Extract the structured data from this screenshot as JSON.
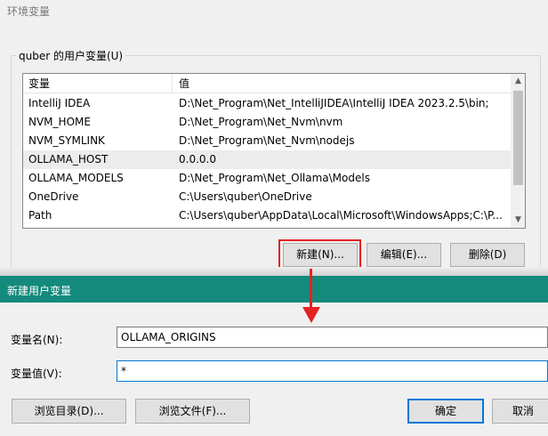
{
  "window": {
    "title": "环境变量"
  },
  "user_vars": {
    "group_label": "quber 的用户变量(U)",
    "columns": [
      "变量",
      "值"
    ],
    "rows": [
      {
        "name": "IntelliJ IDEA",
        "value": "D:\\Net_Program\\Net_IntelliJIDEA\\IntelliJ IDEA 2023.2.5\\bin;"
      },
      {
        "name": "NVM_HOME",
        "value": "D:\\Net_Program\\Net_Nvm\\nvm"
      },
      {
        "name": "NVM_SYMLINK",
        "value": "D:\\Net_Program\\Net_Nvm\\nodejs"
      },
      {
        "name": "OLLAMA_HOST",
        "value": "0.0.0.0",
        "selected": true
      },
      {
        "name": "OLLAMA_MODELS",
        "value": "D:\\Net_Program\\Net_Ollama\\Models"
      },
      {
        "name": "OneDrive",
        "value": "C:\\Users\\quber\\OneDrive"
      },
      {
        "name": "Path",
        "value": "C:\\Users\\quber\\AppData\\Local\\Microsoft\\WindowsApps;C:\\P..."
      }
    ],
    "buttons": {
      "new": "新建(N)...",
      "edit": "编辑(E)...",
      "delete": "删除(D)"
    }
  },
  "new_var_dialog": {
    "title": "新建用户变量",
    "name_label": "变量名(N):",
    "name_value": "OLLAMA_ORIGINS",
    "value_label": "变量值(V):",
    "value_value": "*",
    "buttons": {
      "browse_dir": "浏览目录(D)...",
      "browse_file": "浏览文件(F)...",
      "ok": "确定",
      "cancel": "取消"
    }
  },
  "accent_colors": {
    "highlight": "#e32222",
    "dialog_bar": "#138a7c",
    "focus": "#0078d7"
  },
  "icons": {
    "scroll_up": "▲",
    "scroll_down": "▼"
  }
}
